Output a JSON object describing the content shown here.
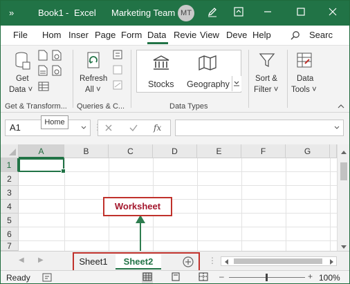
{
  "titlebar": {
    "quick_access": "»",
    "doc_name": "Book1",
    "separator": "-",
    "app_name": "Excel",
    "account_name": "Marketing Team",
    "avatar_initials": "MT"
  },
  "tabs": [
    "File",
    "Hom",
    "Inser",
    "Page",
    "Form",
    "Data",
    "Revie",
    "View",
    "Deve",
    "Help",
    "Searc"
  ],
  "active_tab": "Data",
  "ribbon": {
    "get_data": "Get",
    "get_data2": "Data ˅",
    "refresh": "Refresh",
    "refresh2": "All ˅",
    "stocks": "Stocks",
    "geography": "Geography",
    "sort_filter": "Sort &",
    "sort_filter2": "Filter ˅",
    "data_tools": "Data",
    "data_tools2": "Tools ˅",
    "group_get": "Get & Transform...",
    "group_queries": "Queries & C...",
    "group_types": "Data Types"
  },
  "tooltip": "Home",
  "formula_bar": {
    "name_box": "A1",
    "fx": "fx"
  },
  "columns": [
    "A",
    "B",
    "C",
    "D",
    "E",
    "F",
    "G"
  ],
  "rows": [
    "1",
    "2",
    "3",
    "4",
    "5",
    "6",
    "7"
  ],
  "annotation": "Worksheet",
  "sheets": [
    "Sheet1",
    "Sheet2"
  ],
  "active_sheet": "Sheet2",
  "status": {
    "ready": "Ready",
    "zoom": "100%"
  },
  "colors": {
    "excel_green": "#217346",
    "annotation_red": "#c0312b"
  }
}
